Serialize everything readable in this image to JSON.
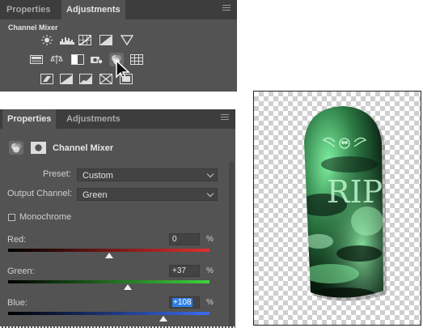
{
  "adjustments_panel": {
    "tabs": [
      {
        "label": "Properties"
      },
      {
        "label": "Adjustments"
      }
    ],
    "section_title": "Channel Mixer",
    "icons": {
      "row1": [
        "brightness-contrast-icon",
        "levels-icon",
        "curves-icon",
        "exposure-icon",
        "gradient-triangle-icon"
      ],
      "row2": [
        "vibrance-icon",
        "hue-saturation-icon",
        "color-balance-icon",
        "black-white-icon",
        "photo-filter-icon",
        "channel-mixer-icon",
        "color-lookup-icon"
      ],
      "row3": [
        "invert-icon",
        "posterize-icon",
        "threshold-icon",
        "gradient-map-icon",
        "selective-color-icon"
      ]
    }
  },
  "properties_panel": {
    "tabs": [
      {
        "label": "Properties"
      },
      {
        "label": "Adjustments"
      }
    ],
    "title": "Channel Mixer",
    "preset_label": "Preset:",
    "preset_value": "Custom",
    "output_channel_label": "Output Channel:",
    "output_channel_value": "Green",
    "monochrome_label": "Monochrome",
    "monochrome_checked": false,
    "sliders": [
      {
        "label": "Red:",
        "value": "0",
        "unit": "%",
        "level_percent": 0
      },
      {
        "label": "Green:",
        "value": "+37",
        "unit": "%",
        "level_percent": 37
      },
      {
        "label": "Blue:",
        "value": "+108",
        "unit": "%",
        "level_percent": 108
      }
    ]
  },
  "preview": {
    "engraving": "RIP",
    "colors": {
      "tombstone_dark": "#0b1f12",
      "tombstone_glow": "#6fe08f",
      "background_check": "#cfcfcf"
    }
  }
}
